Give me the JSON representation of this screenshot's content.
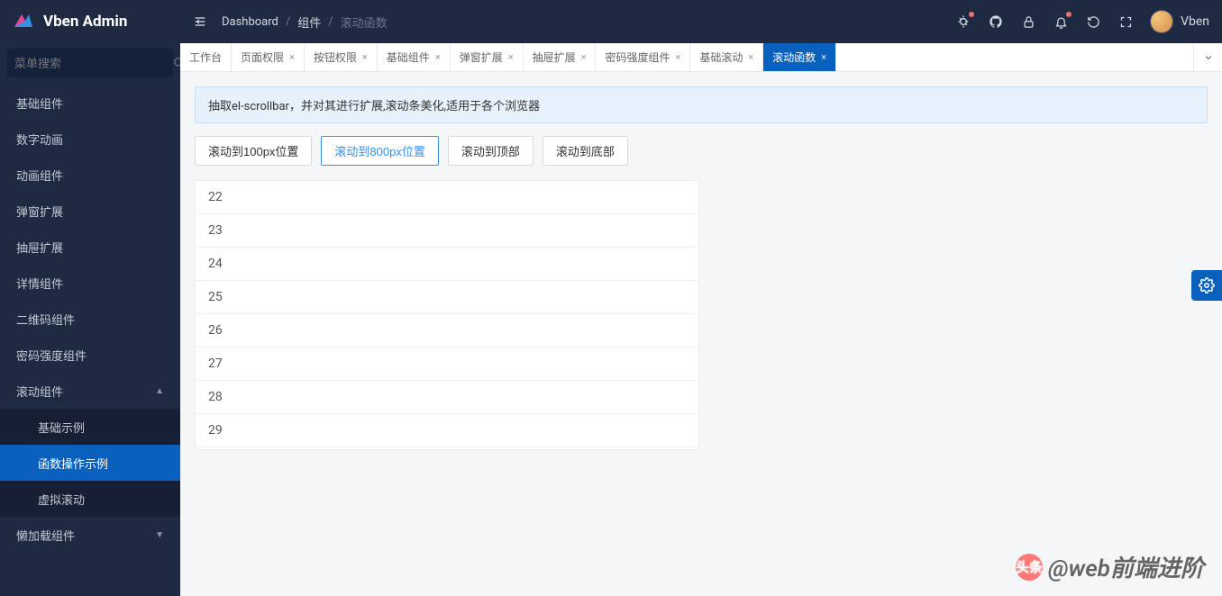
{
  "app": {
    "name": "Vben Admin",
    "username": "Vben"
  },
  "search": {
    "placeholder": "菜单搜索"
  },
  "sidebar": {
    "items": [
      {
        "label": "基础组件",
        "expandable": false
      },
      {
        "label": "数字动画",
        "expandable": false
      },
      {
        "label": "动画组件",
        "expandable": false
      },
      {
        "label": "弹窗扩展",
        "expandable": false
      },
      {
        "label": "抽屉扩展",
        "expandable": false
      },
      {
        "label": "详情组件",
        "expandable": false
      },
      {
        "label": "二维码组件",
        "expandable": false
      },
      {
        "label": "密码强度组件",
        "expandable": false
      },
      {
        "label": "滚动组件",
        "expandable": true,
        "expanded": true
      },
      {
        "label": "懒加载组件",
        "expandable": true,
        "expanded": false
      }
    ],
    "subitems": [
      {
        "label": "基础示例",
        "active": false
      },
      {
        "label": "函数操作示例",
        "active": true
      },
      {
        "label": "虚拟滚动",
        "active": false
      }
    ]
  },
  "breadcrumb": [
    "Dashboard",
    "组件",
    "滚动函数"
  ],
  "tabs": [
    {
      "label": "工作台",
      "closable": false,
      "active": false
    },
    {
      "label": "页面权限",
      "closable": true,
      "active": false
    },
    {
      "label": "按钮权限",
      "closable": true,
      "active": false
    },
    {
      "label": "基础组件",
      "closable": true,
      "active": false
    },
    {
      "label": "弹窗扩展",
      "closable": true,
      "active": false
    },
    {
      "label": "抽屉扩展",
      "closable": true,
      "active": false
    },
    {
      "label": "密码强度组件",
      "closable": true,
      "active": false
    },
    {
      "label": "基础滚动",
      "closable": true,
      "active": false
    },
    {
      "label": "滚动函数",
      "closable": true,
      "active": true
    }
  ],
  "page": {
    "alert": "抽取el-scrollbar，并对其进行扩展,滚动条美化,适用于各个浏览器",
    "buttons": [
      "滚动到100px位置",
      "滚动到800px位置",
      "滚动到顶部",
      "滚动到底部"
    ],
    "activeButtonIndex": 1,
    "listItems": [
      "22",
      "23",
      "24",
      "25",
      "26",
      "27",
      "28",
      "29"
    ]
  },
  "watermark": {
    "badge": "头条",
    "text": "@web前端进阶"
  }
}
